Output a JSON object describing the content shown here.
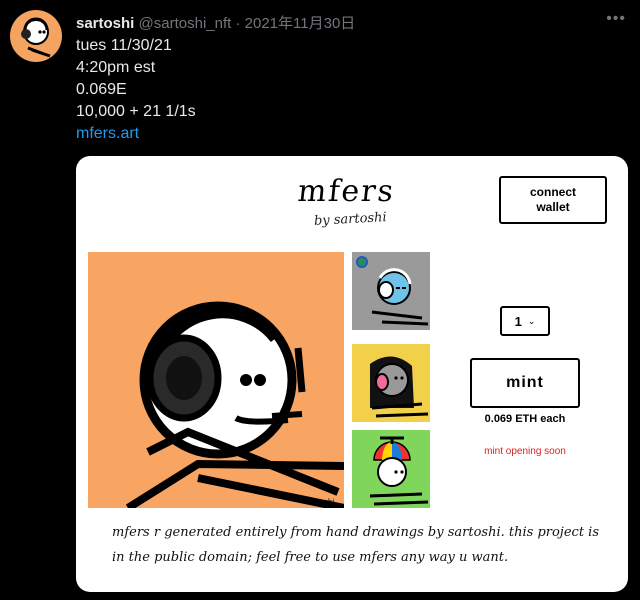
{
  "tweet": {
    "author_name": "sartoshi",
    "author_handle": "@sartoshi_nft",
    "separator": "·",
    "date": "2021年11月30日",
    "more_icon": "more-icon",
    "lines": [
      "tues 11/30/21",
      "4:20pm est",
      "0.069E",
      "10,000 + 21 1/1s"
    ],
    "link": "mfers.art"
  },
  "card": {
    "logo": "mfers",
    "byline": "by sartoshi",
    "connect_wallet_label": "connect\nwallet",
    "quantity": "1",
    "mint_label": "mint",
    "price": "0.069 ETH each",
    "status": "mint opening soon",
    "hero_signature": "sartoshi",
    "description": "mfers r generated entirely from hand drawings by sartoshi. this project is in the public domain; feel free to use mfers any way u want."
  },
  "colors": {
    "link": "#1d9bf0",
    "status": "#d62020",
    "hero_bg": "#f8a463"
  }
}
